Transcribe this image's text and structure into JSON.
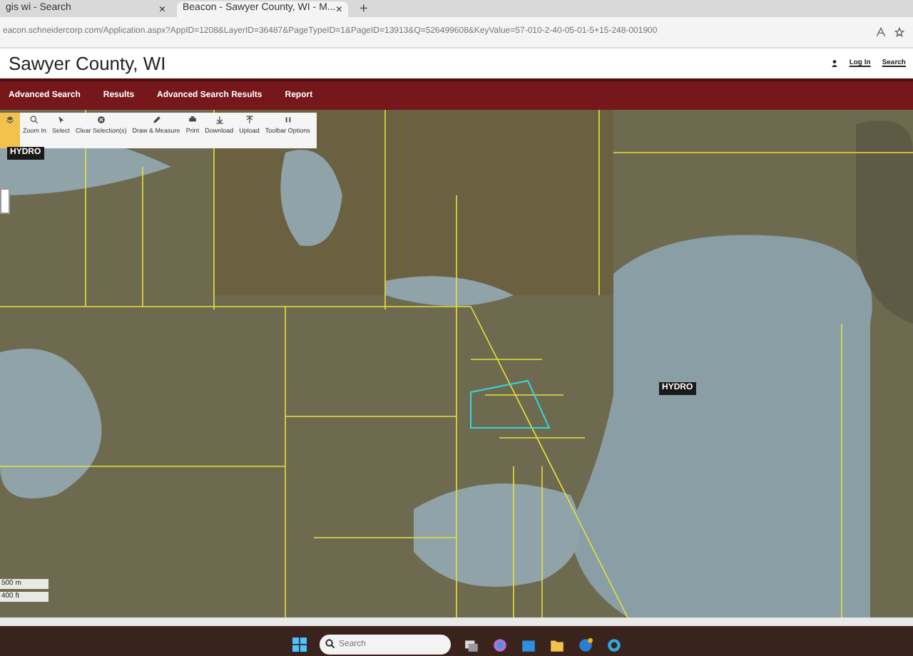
{
  "browser": {
    "tabs": [
      {
        "title": "gis wi - Search",
        "close": "×",
        "selected": false
      },
      {
        "title": "Beacon - Sawyer County, WI - M...",
        "close": "×",
        "selected": true
      }
    ],
    "new_tab": "+",
    "url": "eacon.schneidercorp.com/Application.aspx?AppID=1208&LayerID=36487&PageTypeID=1&PageID=13913&Q=526499608&KeyValue=57-010-2-40-05-01-5+15-248-001900"
  },
  "site": {
    "title": "Sawyer County, WI",
    "links": [
      "Log In",
      "Search"
    ]
  },
  "nav": [
    "Advanced Search",
    "Results",
    "Advanced Search Results",
    "Report"
  ],
  "toolbar": [
    {
      "kind": "layers",
      "selected": true
    },
    {
      "kind": "zoom",
      "label": "Zoom In",
      "selected": false
    },
    {
      "kind": "select",
      "label": "Select",
      "selected": false
    },
    {
      "kind": "clear",
      "label": "Clear Selection(s)",
      "selected": false
    },
    {
      "kind": "draw",
      "label": "Draw & Measure",
      "selected": false
    },
    {
      "kind": "print",
      "label": "Print",
      "selected": false
    },
    {
      "kind": "download",
      "label": "Download",
      "selected": false
    },
    {
      "kind": "upload",
      "label": "Upload",
      "selected": false
    },
    {
      "kind": "options",
      "label": "Toolbar Options",
      "selected": false
    }
  ],
  "map": {
    "labels": [
      "HYDRO",
      "HYDRO"
    ],
    "scale": [
      "500 m",
      "400 ft"
    ]
  },
  "taskbar": {
    "search": {
      "placeholder": "Search"
    }
  }
}
